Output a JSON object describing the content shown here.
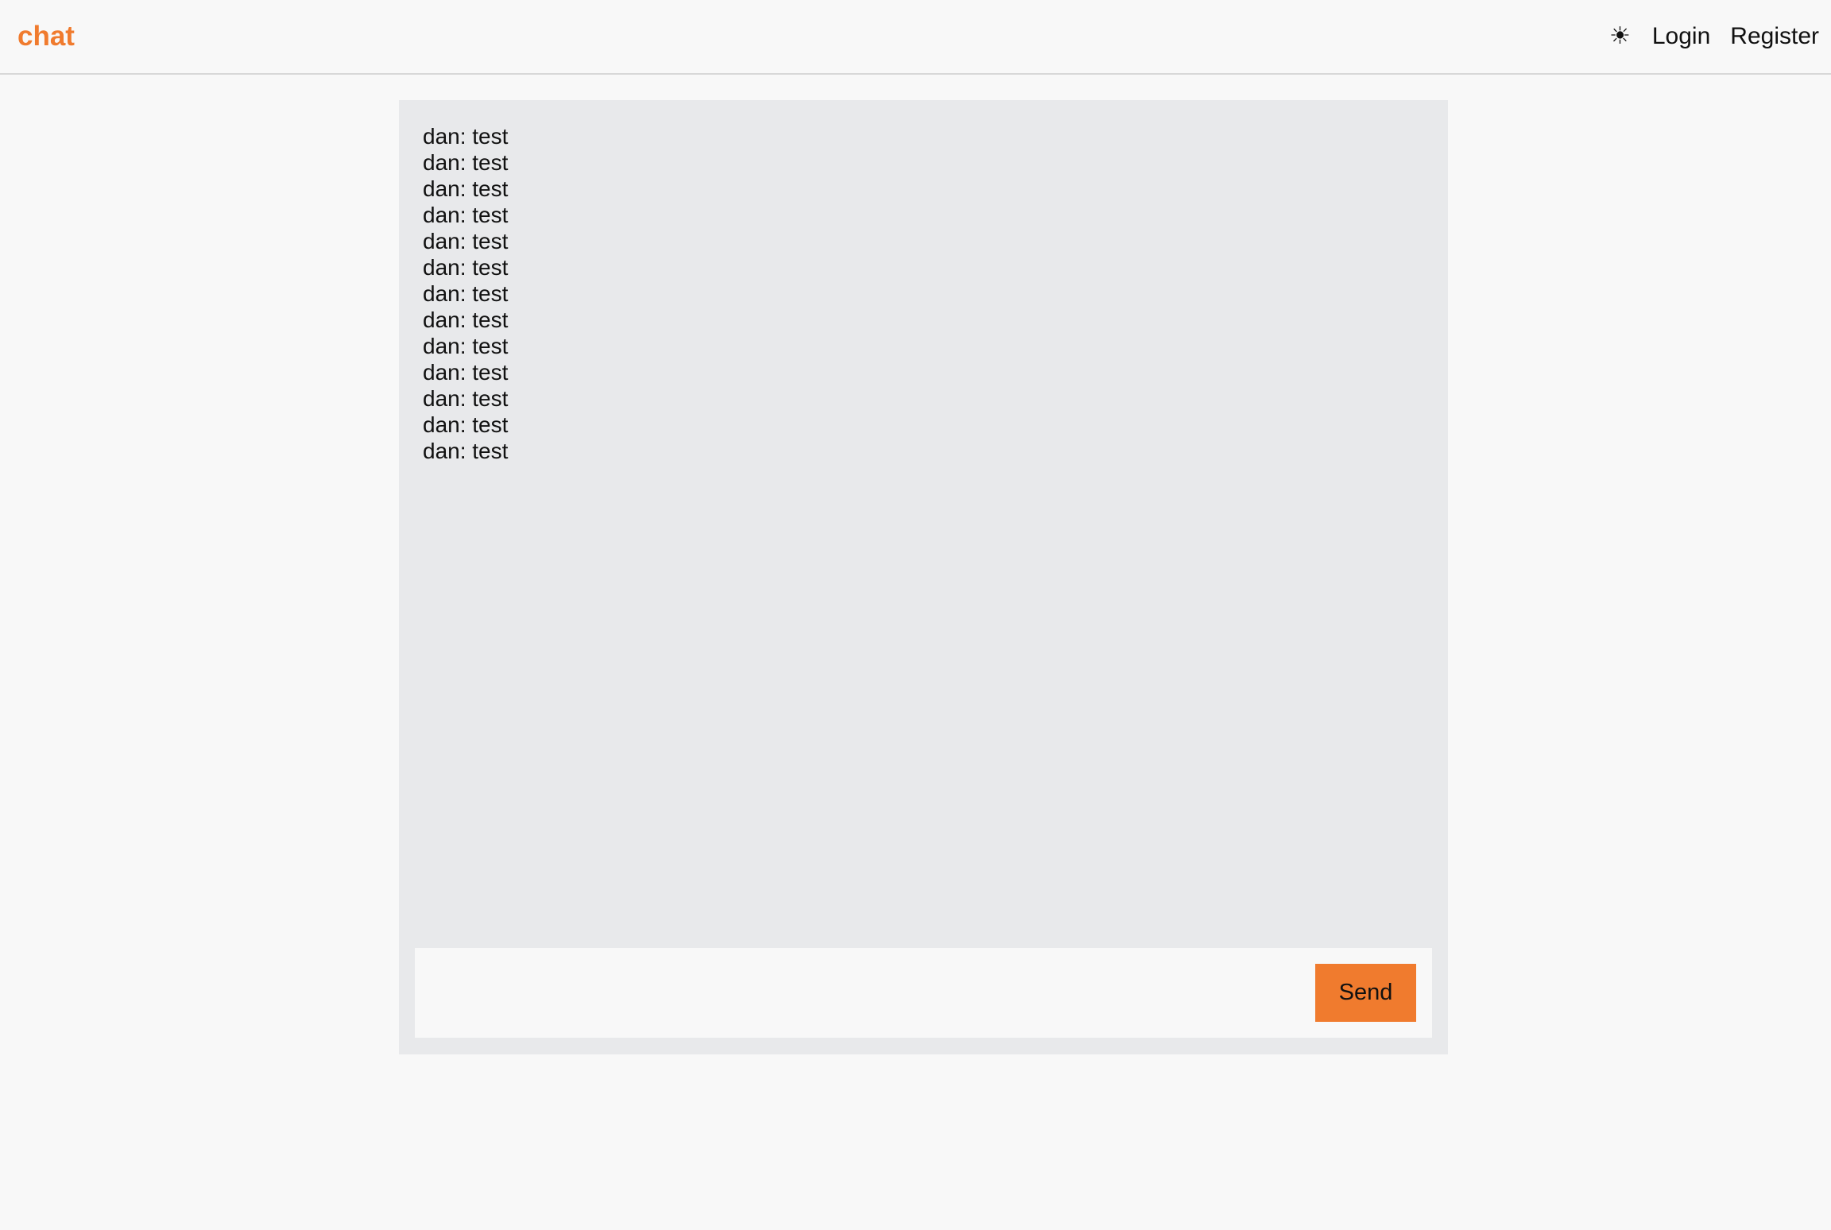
{
  "navbar": {
    "brand": "chat",
    "theme_toggle_icon": "☀",
    "theme_toggle_icon_name": "sun-icon",
    "login_label": "Login",
    "register_label": "Register"
  },
  "chat": {
    "messages": [
      {
        "text": "dan: test"
      },
      {
        "text": "dan: test"
      },
      {
        "text": "dan: test"
      },
      {
        "text": "dan: test"
      },
      {
        "text": "dan: test"
      },
      {
        "text": "dan: test"
      },
      {
        "text": "dan: test"
      },
      {
        "text": "dan: test"
      },
      {
        "text": "dan: test"
      },
      {
        "text": "dan: test"
      },
      {
        "text": "dan: test"
      },
      {
        "text": "dan: test"
      },
      {
        "text": "dan: test"
      }
    ],
    "input_value": "",
    "send_label": "Send"
  },
  "colors": {
    "accent": "#f07b2e",
    "page_background": "#f8f8f8",
    "panel_background": "#e8e9eb"
  }
}
